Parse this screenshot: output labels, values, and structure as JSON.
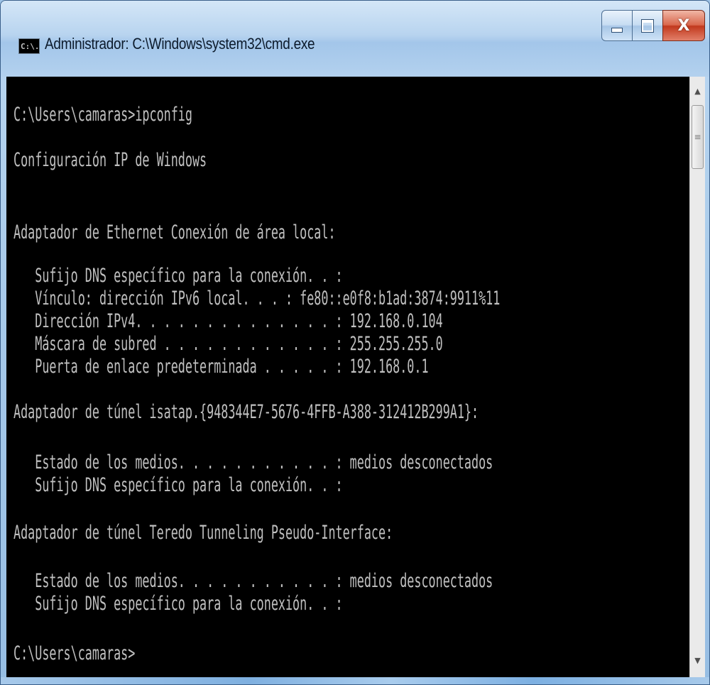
{
  "window": {
    "title": "Administrador: C:\\Windows\\system32\\cmd.exe",
    "icon_label": "C:\\.",
    "controls": {
      "minimize": "minimize-icon",
      "maximize": "maximize-icon",
      "close": "X"
    }
  },
  "colors": {
    "console_bg": "#000000",
    "console_text": "#c0c0c0",
    "close_button": "#c1391d"
  },
  "console": {
    "lines": [
      {
        "text": "C:\\Users\\camaras>ipconfig"
      },
      {
        "text": "Configuración IP de Windows"
      },
      {
        "text": "Adaptador de Ethernet Conexión de área local:"
      },
      {
        "text": "   Sufijo DNS específico para la conexión. . :"
      },
      {
        "text": "   Vínculo: dirección IPv6 local. . . : fe80::e0f8:b1ad:3874:9911%11"
      },
      {
        "text": "   Dirección IPv4. . . . . . . . . . . . . . : 192.168.0.104"
      },
      {
        "text": "   Máscara de subred . . . . . . . . . . . . : 255.255.255.0"
      },
      {
        "text": "   Puerta de enlace predeterminada . . . . . : 192.168.0.1"
      },
      {
        "text": "Adaptador de túnel isatap.{948344E7-5676-4FFB-A388-312412B299A1}:"
      },
      {
        "text": "   Estado de los medios. . . . . . . . . . . : medios desconectados"
      },
      {
        "text": "   Sufijo DNS específico para la conexión. . :"
      },
      {
        "text": "Adaptador de túnel Teredo Tunneling Pseudo-Interface:"
      },
      {
        "text": "   Estado de los medios. . . . . . . . . . . : medios desconectados"
      },
      {
        "text": "   Sufijo DNS específico para la conexión. . :"
      },
      {
        "text": "C:\\Users\\camaras>"
      }
    ]
  },
  "scrollbar": {
    "up": "▲",
    "down": "▼",
    "grip": "≡"
  }
}
